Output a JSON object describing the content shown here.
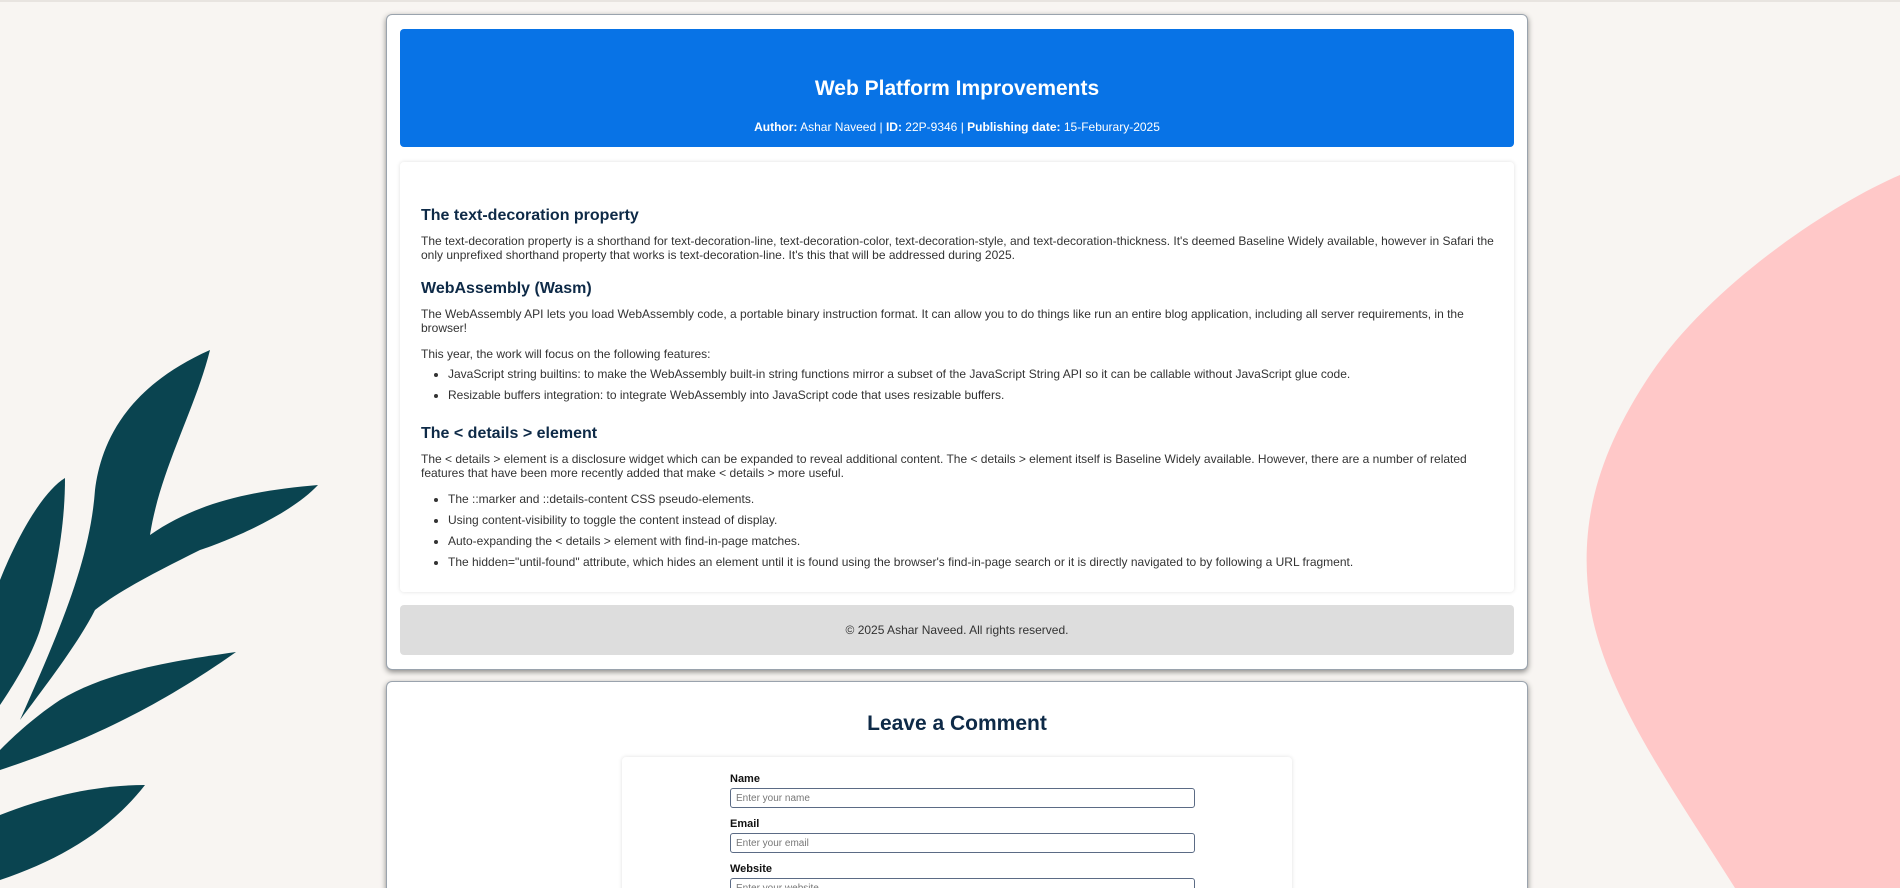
{
  "article": {
    "title": "Web Platform Improvements",
    "meta": {
      "author_label": "Author:",
      "author": "Ashar Naveed",
      "id_label": "ID:",
      "id": "22P-9346",
      "date_label": "Publishing date:",
      "date": "15-Feburary-2025"
    },
    "sections": [
      {
        "heading": "The text-decoration property",
        "paragraph": "The text-decoration property is a shorthand for text-decoration-line, text-decoration-color, text-decoration-style, and text-decoration-thickness. It's deemed Baseline Widely available, however in Safari the only unprefixed shorthand property that works is text-decoration-line. It's this that will be addressed during 2025."
      },
      {
        "heading": "WebAssembly (Wasm)",
        "paragraph": "The WebAssembly API lets you load WebAssembly code, a portable binary instruction format. It can allow you to do things like run an entire blog application, including all server requirements, in the browser!",
        "paragraph2": "This year, the work will focus on the following features:",
        "items": [
          "JavaScript string builtins: to make the WebAssembly built-in string functions mirror a subset of the JavaScript String API so it can be callable without JavaScript glue code.",
          "Resizable buffers integration: to integrate WebAssembly into JavaScript code that uses resizable buffers."
        ]
      },
      {
        "heading": "The < details > element",
        "paragraph": "The < details > element is a disclosure widget which can be expanded to reveal additional content. The < details > element itself is Baseline Widely available. However, there are a number of related features that have been more recently added that make < details > more useful.",
        "items": [
          "The ::marker and ::details-content CSS pseudo-elements.",
          "Using content-visibility to toggle the content instead of display.",
          "Auto-expanding the < details > element with find-in-page matches.",
          "The hidden=\"until-found\" attribute, which hides an element until it is found using the browser's find-in-page search or it is directly navigated to by following a URL fragment."
        ]
      }
    ],
    "footer": "© 2025 Ashar Naveed. All rights reserved."
  },
  "comment": {
    "title": "Leave a Comment",
    "name_label": "Name",
    "name_placeholder": "Enter your name",
    "email_label": "Email",
    "email_placeholder": "Enter your email",
    "website_label": "Website",
    "website_placeholder": "Enter your website"
  },
  "colors": {
    "background": "#f8f5f2",
    "header_blue": "#0873e6",
    "leaf": "#0a4450",
    "blob": "#ffc8c8",
    "heading": "#0e2a47",
    "footer_bg": "#dddddd"
  },
  "decorations": [
    "leaf-illustration",
    "pink-blob"
  ]
}
